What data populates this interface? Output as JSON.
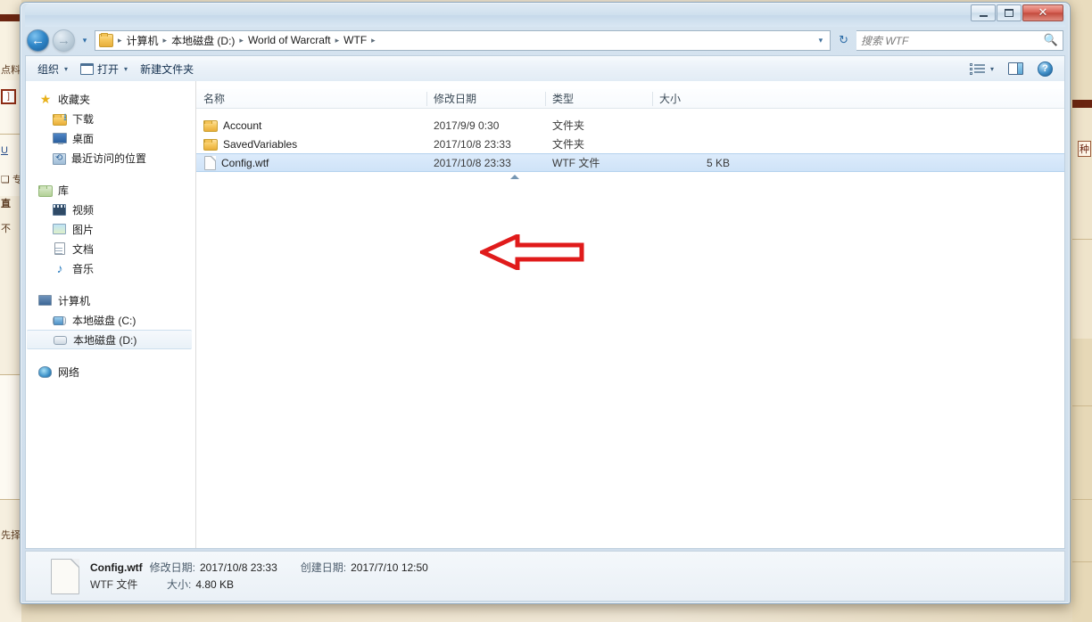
{
  "window": {
    "controls": {
      "minimize": "—",
      "maximize": "□",
      "close": "✕"
    }
  },
  "address": {
    "back_icon": "back-arrow-icon",
    "forward_icon": "forward-arrow-icon",
    "history_caret": "▾",
    "breadcrumbs": [
      "计算机",
      "本地磁盘 (D:)",
      "World of Warcraft",
      "WTF"
    ],
    "separator": "▸",
    "dropdown_caret": "▾",
    "refresh_icon": "↻"
  },
  "search": {
    "placeholder": "搜索 WTF",
    "icon": "search-icon"
  },
  "toolbar": {
    "organize": "组织",
    "open": "打开",
    "new_folder": "新建文件夹",
    "caret": "▾",
    "view_icon": "view-layout-icon",
    "preview_pane_icon": "preview-pane-icon",
    "help_icon": "?"
  },
  "navpane": {
    "groups": [
      {
        "header": {
          "label": "收藏夹",
          "icon": "star-icon"
        },
        "items": [
          {
            "label": "下载",
            "icon": "downloads-folder-icon"
          },
          {
            "label": "桌面",
            "icon": "desktop-icon"
          },
          {
            "label": "最近访问的位置",
            "icon": "recent-places-icon"
          }
        ]
      },
      {
        "header": {
          "label": "库",
          "icon": "library-icon"
        },
        "items": [
          {
            "label": "视频",
            "icon": "video-icon"
          },
          {
            "label": "图片",
            "icon": "pictures-icon"
          },
          {
            "label": "文档",
            "icon": "documents-icon"
          },
          {
            "label": "音乐",
            "icon": "music-icon"
          }
        ]
      },
      {
        "header": {
          "label": "计算机",
          "icon": "computer-icon"
        },
        "items": [
          {
            "label": "本地磁盘 (C:)",
            "icon": "system-drive-icon",
            "selected": false
          },
          {
            "label": "本地磁盘 (D:)",
            "icon": "drive-icon",
            "selected": true
          }
        ]
      },
      {
        "header": {
          "label": "网络",
          "icon": "network-icon"
        },
        "items": []
      }
    ]
  },
  "filelist": {
    "columns": [
      "名称",
      "修改日期",
      "类型",
      "大小"
    ],
    "sort_indicator": "ascending-sort-icon",
    "rows": [
      {
        "name": "Account",
        "date": "2017/9/9 0:30",
        "type": "文件夹",
        "size": "",
        "icon": "folder-icon",
        "selected": false
      },
      {
        "name": "SavedVariables",
        "date": "2017/10/8 23:33",
        "type": "文件夹",
        "size": "",
        "icon": "folder-icon",
        "selected": false
      },
      {
        "name": "Config.wtf",
        "date": "2017/10/8 23:33",
        "type": "WTF 文件",
        "size": "5 KB",
        "icon": "generic-file-icon",
        "selected": true
      }
    ]
  },
  "annotation": {
    "arrow_color": "#e01b1b",
    "direction": "left"
  },
  "status": {
    "file_name": "Config.wtf",
    "modified_label": "修改日期:",
    "modified_value": "2017/10/8 23:33",
    "created_label": "创建日期:",
    "created_value": "2017/7/10 12:50",
    "file_type": "WTF 文件",
    "size_label": "大小:",
    "size_value": "4.80 KB",
    "icon": "file-preview-icon"
  },
  "background_left": {
    "texts": [
      "点料",
      "]",
      "U",
      "❑ 专",
      "直",
      "不",
      "先择"
    ]
  },
  "background_right": {
    "texts": [
      "种"
    ]
  }
}
